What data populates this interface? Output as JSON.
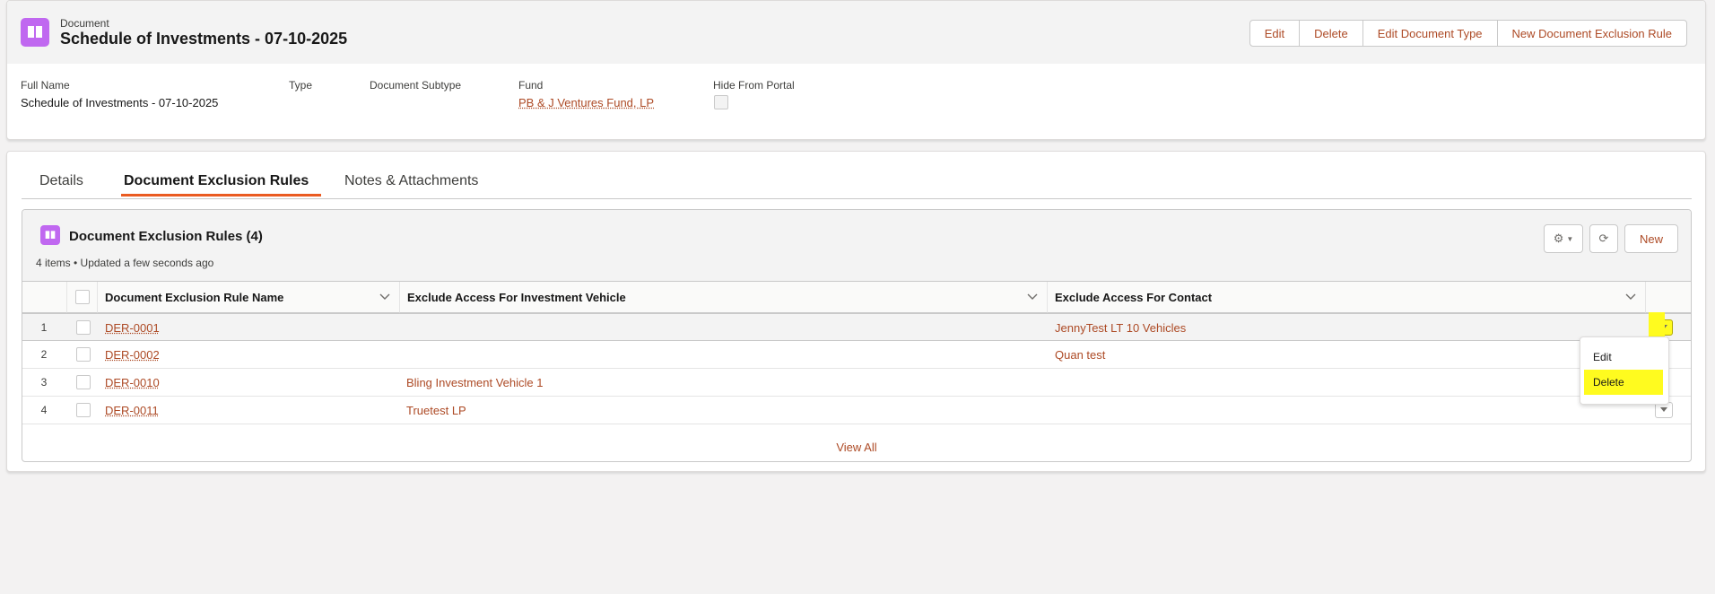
{
  "header": {
    "object_label": "Document",
    "title": "Schedule of Investments - 07-10-2025",
    "buttons": [
      "Edit",
      "Delete",
      "Edit Document Type",
      "New Document Exclusion Rule"
    ],
    "fields": [
      {
        "label": "Full Name",
        "value": "Schedule of Investments - 07-10-2025"
      },
      {
        "label": "Type",
        "value": ""
      },
      {
        "label": "Document Subtype",
        "value": ""
      },
      {
        "label": "Fund",
        "value": "PB & J Ventures Fund, LP"
      },
      {
        "label": "Hide From Portal",
        "checked": false
      }
    ]
  },
  "tabs": [
    {
      "label": "Details",
      "active": false
    },
    {
      "label": "Document Exclusion Rules",
      "active": true
    },
    {
      "label": "Notes & Attachments",
      "active": false
    }
  ],
  "related_list": {
    "title": "Document Exclusion Rules (4)",
    "meta": "4 items • Updated a few seconds ago",
    "new_label": "New",
    "columns": [
      "Document Exclusion Rule Name",
      "Exclude Access For Investment Vehicle",
      "Exclude Access For Contact"
    ],
    "rows": [
      {
        "num": "1",
        "name": "DER-0001",
        "vehicle": "",
        "contact": "JennyTest LT 10 Vehicles"
      },
      {
        "num": "2",
        "name": "DER-0002",
        "vehicle": "",
        "contact": "Quan test"
      },
      {
        "num": "3",
        "name": "DER-0010",
        "vehicle": "Bling Investment Vehicle 1",
        "contact": ""
      },
      {
        "num": "4",
        "name": "DER-0011",
        "vehicle": "Truetest LP",
        "contact": ""
      }
    ],
    "view_all": "View All"
  },
  "row_menu": {
    "items": [
      "Edit",
      "Delete"
    ]
  },
  "colors": {
    "accent": "#ad4a25",
    "tab_underline": "#ea5b21",
    "icon_bg": "#c068f0",
    "highlight": "#fffb1f"
  }
}
